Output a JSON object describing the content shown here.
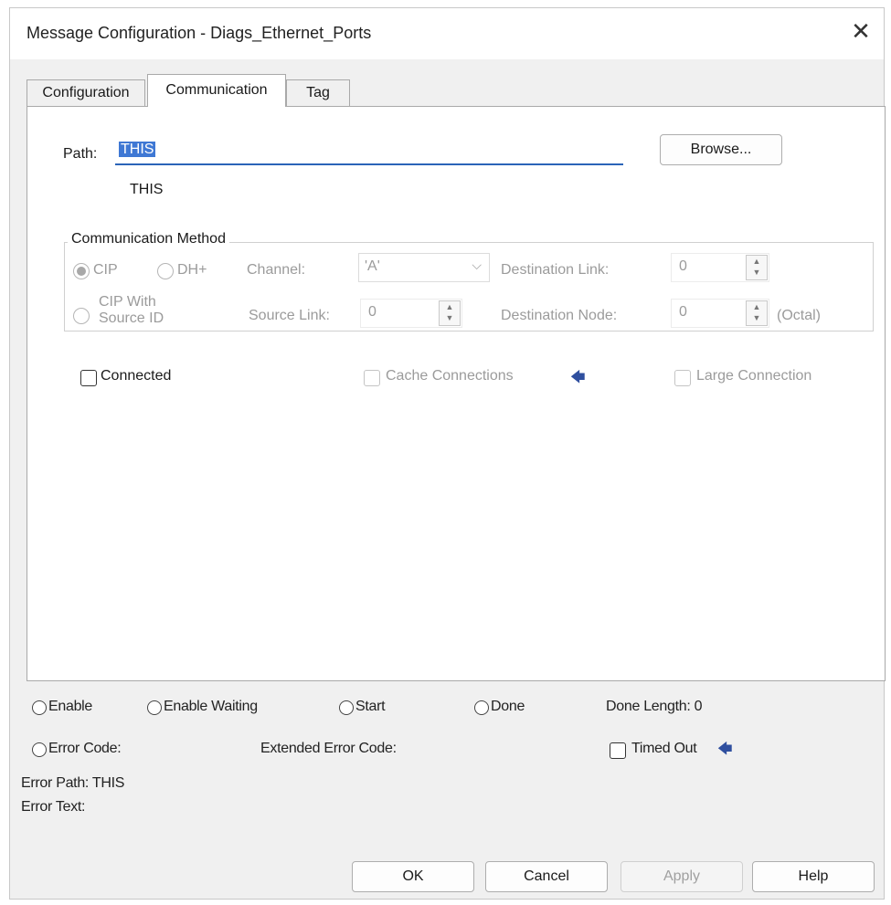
{
  "window": {
    "title": "Message Configuration - Diags_Ethernet_Ports",
    "close_glyph": "✕"
  },
  "tabs": [
    "Configuration",
    "Communication",
    "Tag"
  ],
  "communication": {
    "path_label": "Path:",
    "path_value": "THIS",
    "path_resolved": "THIS",
    "browse_label": "Browse...",
    "method_group_title": "Communication Method",
    "cip_label": "CIP",
    "dh_plus_label": "DH+",
    "channel_label": "Channel:",
    "channel_value": "'A'",
    "destination_link_label": "Destination Link:",
    "destination_link_value": "0",
    "cip_source_id_label_1": "CIP With",
    "cip_source_id_label_2": "Source ID",
    "source_link_label": "Source Link:",
    "source_link_value": "0",
    "destination_node_label": "Destination Node:",
    "destination_node_value": "0",
    "octal_label": "(Octal)",
    "connected_label": "Connected",
    "cache_connections_label": "Cache Connections",
    "large_connection_label": "Large Connection"
  },
  "status": {
    "enable_label": "Enable",
    "enable_waiting_label": "Enable Waiting",
    "start_label": "Start",
    "done_label": "Done",
    "done_length_label": "Done Length: 0",
    "error_code_label": "Error Code:",
    "extended_error_code_label": "Extended Error Code:",
    "timed_out_label": "Timed Out",
    "error_path_label": "Error Path: THIS",
    "error_text_label": "Error Text:"
  },
  "buttons": {
    "ok": "OK",
    "cancel": "Cancel",
    "apply": "Apply",
    "help": "Help"
  },
  "colors": {
    "selection": "#3f78d4",
    "focus_underline": "#2b64b8",
    "arrow": "#2f4f9f",
    "dialog_bg": "#f0f0f0"
  },
  "icons": {
    "arrow": "left-arrow-icon"
  }
}
